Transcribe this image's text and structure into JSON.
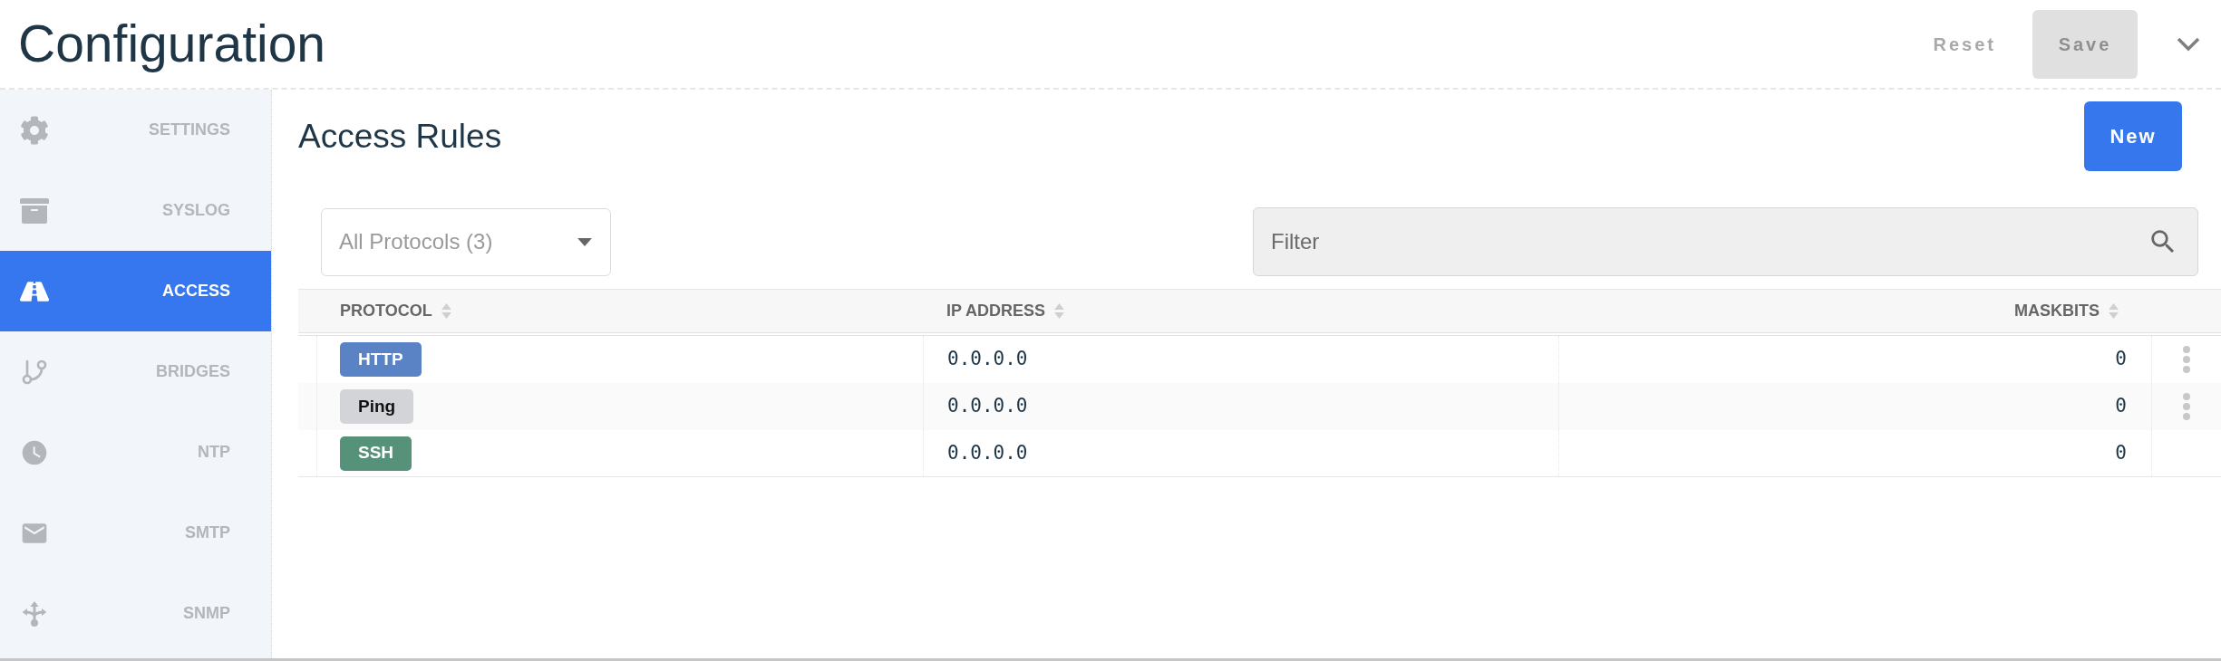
{
  "header": {
    "title": "Configuration",
    "buttons": [
      {
        "label": "Reset",
        "kind": "text",
        "disabled": true
      },
      {
        "label": "Save",
        "kind": "filled",
        "disabled": true
      }
    ]
  },
  "sidebar": {
    "items": [
      {
        "label": "SETTINGS",
        "selected": false
      },
      {
        "label": "SYSLOG",
        "selected": false
      },
      {
        "label": "ACCESS",
        "selected": true
      },
      {
        "label": "BRIDGES",
        "selected": false
      },
      {
        "label": "NTP",
        "selected": false
      },
      {
        "label": "SMTP",
        "selected": false
      },
      {
        "label": "SNMP",
        "selected": false
      }
    ]
  },
  "main": {
    "title": "Access Rules",
    "new_button": "New",
    "protocol_select": {
      "value": "All Protocols (3)"
    },
    "filter": {
      "placeholder": "Filter"
    },
    "table": {
      "columns": [
        {
          "label": "PROTOCOL",
          "sortable": true
        },
        {
          "label": "IP ADDRESS",
          "sortable": true
        },
        {
          "label": "MASKBITS",
          "sortable": true
        }
      ],
      "rows": [
        {
          "protocol": "HTTP",
          "color": "#5a83c5",
          "ip_address": "0.0.0.0",
          "maskbits": "0",
          "menu": true
        },
        {
          "protocol": "Ping",
          "color": "#d2d4d7",
          "ip_address": "0.0.0.0",
          "maskbits": "0",
          "menu": true
        },
        {
          "protocol": "SSH",
          "color": "#569179",
          "ip_address": "0.0.0.0",
          "maskbits": "0",
          "menu": false
        }
      ]
    }
  }
}
